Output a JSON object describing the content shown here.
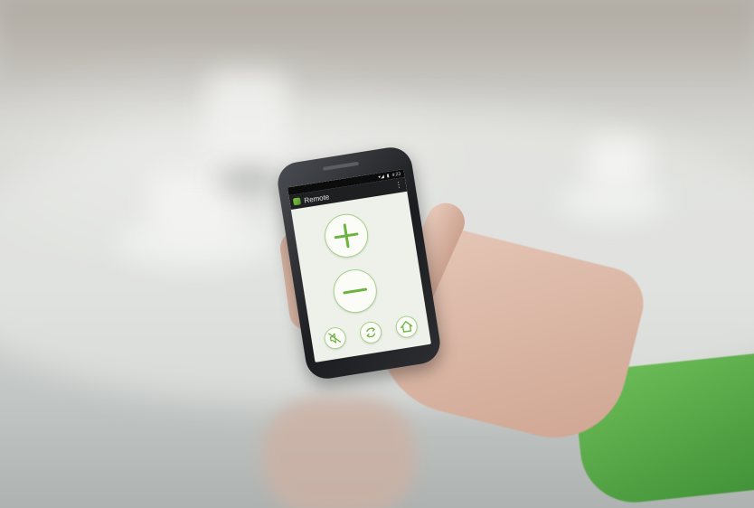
{
  "app": {
    "title": "Remote",
    "status_time": "4:23"
  },
  "controls": [
    {
      "id": "volume-up",
      "icon": "plus-icon"
    },
    {
      "id": "volume-down",
      "icon": "minus-icon"
    },
    {
      "id": "mute",
      "icon": "speaker-mute-icon"
    },
    {
      "id": "program",
      "icon": "refresh-icon"
    },
    {
      "id": "home",
      "icon": "home-icon"
    }
  ],
  "colors": {
    "accent": "#6cb33f",
    "button_fill": "#fbfcf8",
    "app_bar": "#1e1f21",
    "sleeve": "#5aa84a"
  }
}
